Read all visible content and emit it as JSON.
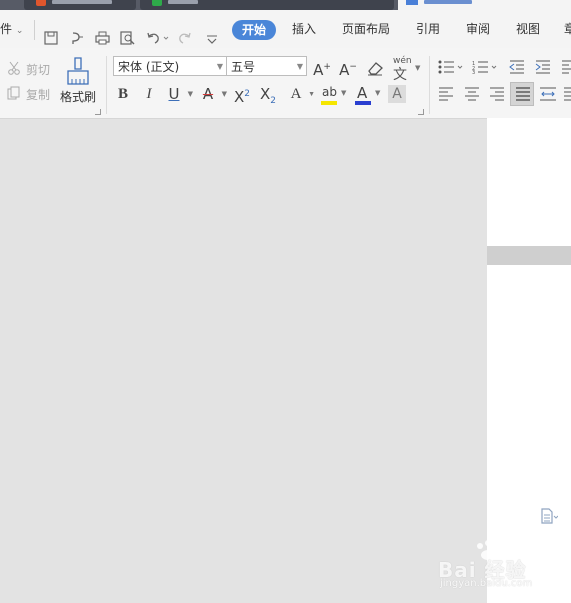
{
  "menu": {
    "file_partial": "件",
    "items": [
      "开始",
      "插入",
      "页面布局",
      "引用",
      "审阅",
      "视图",
      "章"
    ]
  },
  "ribbon": {
    "cut_label": "剪切",
    "copy_label": "复制",
    "format_painter_label": "格式刷",
    "font_name": "宋体 (正文)",
    "font_size": "五号",
    "text_effect_letter": "A",
    "pinyin_glyph": "wén"
  },
  "colors": {
    "accent": "#4a86d8",
    "highlight_bar": "#f5e600",
    "font_color_bar": "#2a3fd0",
    "strike_color": "#d23c3c"
  },
  "watermark": {
    "text": "Bai 经验",
    "sub": "jingyan.baidu.com"
  }
}
